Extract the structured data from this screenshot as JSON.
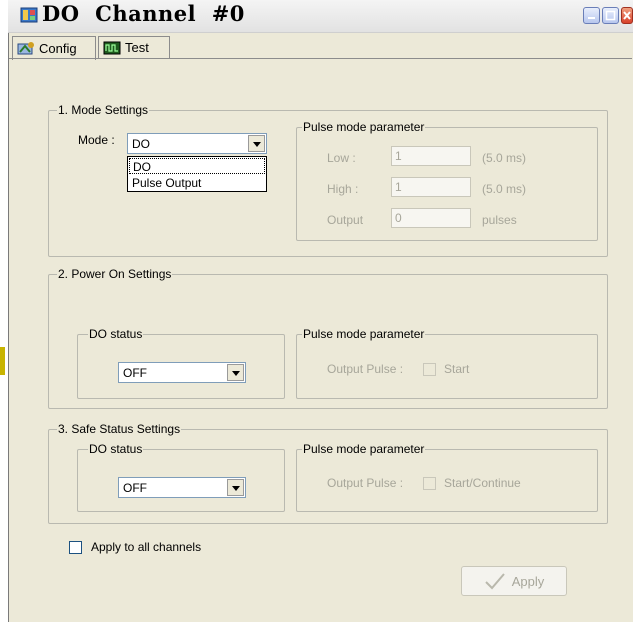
{
  "window": {
    "title": "DO  Channel  #0"
  },
  "tabs": [
    {
      "label": "Config"
    },
    {
      "label": "Test"
    }
  ],
  "mode_settings": {
    "legend": "1. Mode Settings",
    "mode_label": "Mode :",
    "mode_value": "DO",
    "dropdown_options": [
      "DO",
      "Pulse Output"
    ],
    "pulse_group": {
      "legend": "Pulse mode parameter",
      "low_label": "Low :",
      "low_value": "1",
      "low_unit": "(5.0 ms)",
      "high_label": "High :",
      "high_value": "1",
      "high_unit": "(5.0 ms)",
      "output_label": "Output",
      "output_value": "0",
      "output_unit": "pulses"
    }
  },
  "power_on_settings": {
    "legend": "2. Power On Settings",
    "do_status_legend": "DO status",
    "do_status_value": "OFF",
    "pulse_legend": "Pulse mode parameter",
    "output_pulse_label": "Output Pulse :",
    "start_label": "Start"
  },
  "safe_status_settings": {
    "legend": "3. Safe Status Settings",
    "do_status_legend": "DO status",
    "do_status_value": "OFF",
    "pulse_legend": "Pulse mode parameter",
    "output_pulse_label": "Output Pulse :",
    "start_label": "Start/Continue"
  },
  "apply_all_label": "Apply to all channels",
  "apply_button_label": "Apply"
}
